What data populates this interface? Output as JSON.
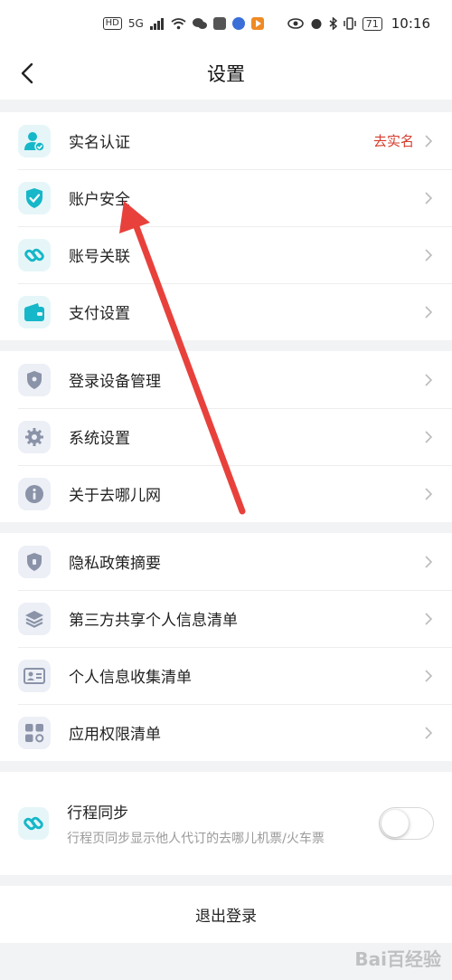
{
  "status_bar": {
    "hd": "HD",
    "signal": "5G",
    "battery": "71",
    "time": "10:16"
  },
  "nav": {
    "title": "设置"
  },
  "groups": [
    {
      "items": [
        {
          "label": "实名认证",
          "extra": "去实名",
          "icon": "user-verify-icon"
        },
        {
          "label": "账户安全",
          "icon": "shield-check-icon"
        },
        {
          "label": "账号关联",
          "icon": "link-icon"
        },
        {
          "label": "支付设置",
          "icon": "wallet-icon"
        }
      ]
    },
    {
      "items": [
        {
          "label": "登录设备管理",
          "icon": "shield-icon"
        },
        {
          "label": "系统设置",
          "icon": "gear-icon"
        },
        {
          "label": "关于去哪儿网",
          "icon": "info-icon"
        }
      ]
    },
    {
      "items": [
        {
          "label": "隐私政策摘要",
          "icon": "privacy-shield-icon"
        },
        {
          "label": "第三方共享个人信息清单",
          "icon": "layers-icon"
        },
        {
          "label": "个人信息收集清单",
          "icon": "id-card-icon"
        },
        {
          "label": "应用权限清单",
          "icon": "grid-icon"
        }
      ]
    }
  ],
  "trip_sync": {
    "title": "行程同步",
    "desc": "行程页同步显示他人代订的去哪儿机票/火车票",
    "enabled": false
  },
  "logout": {
    "label": "退出登录"
  },
  "watermark": "Bai百经验",
  "colors": {
    "accent_teal": "#16b7c8",
    "icon_gray": "#8a93a8",
    "extra_red": "#d43b2c",
    "arrow_red": "#e8413c"
  }
}
